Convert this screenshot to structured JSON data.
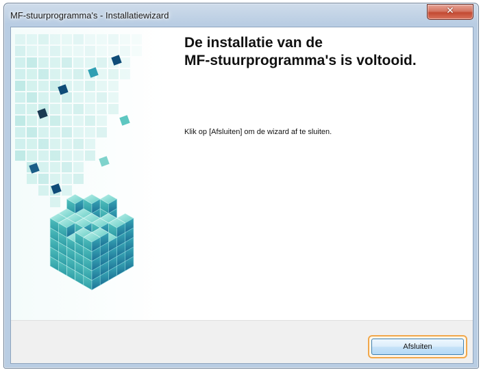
{
  "window": {
    "title": "MF-stuurprogramma's - Installatiewizard",
    "close_icon": "close-icon"
  },
  "content": {
    "heading_line1": "De installatie van de",
    "heading_line2": "MF-stuurprogramma's is voltooid.",
    "instruction": "Klik op [Afsluiten] om de wizard af te sluiten."
  },
  "footer": {
    "finish_label": "Afsluiten"
  },
  "colors": {
    "accent_focus": "#f1a74a",
    "cube_teal": "#3fb8b4",
    "cube_dark": "#0f4c78"
  }
}
